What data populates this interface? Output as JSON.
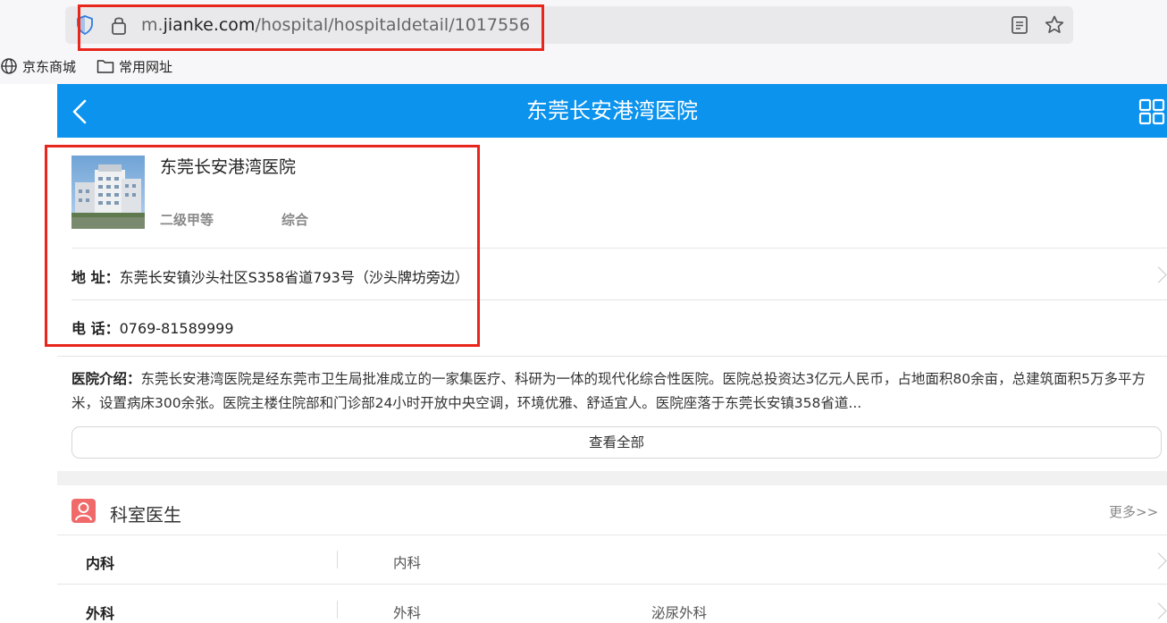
{
  "browser": {
    "url_prefix": "m.",
    "url_domain": "jianke.com",
    "url_path": "/hospital/hospitaldetail/1017556",
    "bookmarks": [
      {
        "label": "京东商城",
        "icon": "globe-icon"
      },
      {
        "label": "常用网址",
        "icon": "folder-icon"
      }
    ]
  },
  "header": {
    "title": "东莞长安港湾医院",
    "back_icon": "chevron-left-icon",
    "menu_icon": "grid-icon"
  },
  "hospital": {
    "name": "东莞长安港湾医院",
    "level": "二级甲等",
    "type": "综合",
    "address_label": "地 址：",
    "address": "东莞长安镇沙头社区S358省道793号（沙头牌坊旁边）",
    "phone_label": "电 话：",
    "phone": "0769-81589999"
  },
  "intro": {
    "label": "医院介绍：",
    "text": "东莞长安港湾医院是经东莞市卫生局批准成立的一家集医疗、科研为一体的现代化综合性医院。医院总投资达3亿元人民币，占地面积80余亩，总建筑面积5万多平方米，设置病床300余张。医院主楼住院部和门诊部24小时开放中央空调，环境优雅、舒适宜人。医院座落于东莞长安镇358省道...",
    "view_all": "查看全部"
  },
  "departments": {
    "title": "科室医生",
    "more": "更多>>",
    "rows": [
      {
        "category": "内科",
        "items": [
          "内科"
        ]
      },
      {
        "category": "外科",
        "items": [
          "外科",
          "泌尿外科"
        ]
      }
    ]
  },
  "colors": {
    "header_bg": "#0b93ee",
    "annotation_red": "#e8261c",
    "dept_icon": "#f06a6a"
  }
}
